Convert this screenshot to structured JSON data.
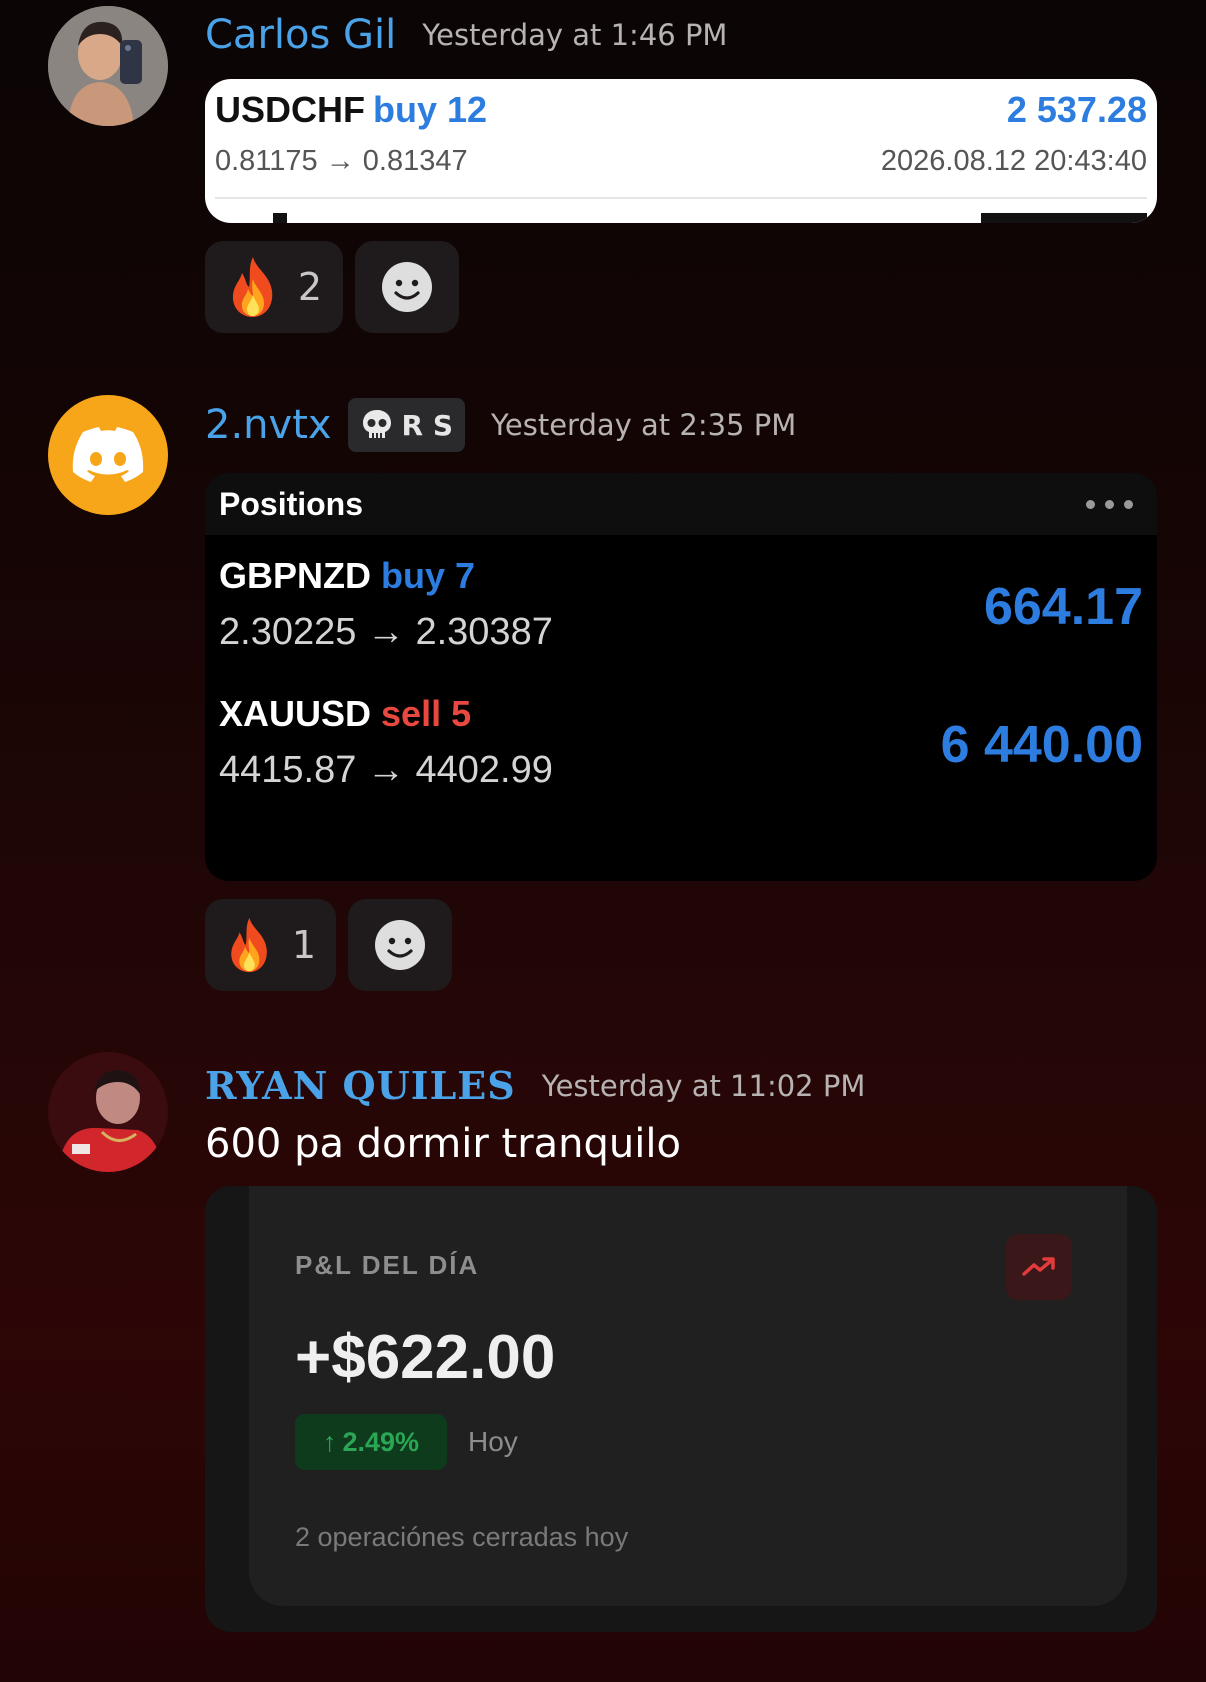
{
  "messages": [
    {
      "author": "Carlos Gil",
      "timestamp": "Yesterday at 1:46 PM",
      "trade": {
        "symbol": "USDCHF",
        "side": "buy 12",
        "profit": "2 537.28",
        "prices": "0.81175 → 0.81347",
        "datetime": "2026.08.12 20:43:40"
      },
      "reactions": [
        {
          "emoji": "fire-icon",
          "count": "2"
        }
      ]
    },
    {
      "author": "2.nvtx",
      "role_tag": "R S",
      "timestamp": "Yesterday at 2:35 PM",
      "positions": {
        "title": "Positions",
        "rows": [
          {
            "symbol": "GBPNZD",
            "side": "buy 7",
            "side_type": "buy",
            "prices": "2.30225 → 2.30387",
            "amount": "664.17"
          },
          {
            "symbol": "XAUUSD",
            "side": "sell 5",
            "side_type": "sell",
            "prices": "4415.87 → 4402.99",
            "amount": "6 440.00"
          }
        ]
      },
      "reactions": [
        {
          "emoji": "fire-icon",
          "count": "1"
        }
      ]
    },
    {
      "author": "RYAN QUILES",
      "timestamp": "Yesterday at 11:02 PM",
      "text": "600 pa dormir tranquilo",
      "pnl": {
        "label": "P&L DEL DÍA",
        "value": "+$622.00",
        "percent": "2.49%",
        "period": "Hoy",
        "footer": "2 operaciónes cerradas hoy"
      }
    }
  ],
  "colors": {
    "username": "#4aa3e8",
    "buy": "#2d7de0",
    "sell": "#e8483f",
    "discord_avatar_bg": "#f8a619",
    "positive": "#2aa655"
  }
}
